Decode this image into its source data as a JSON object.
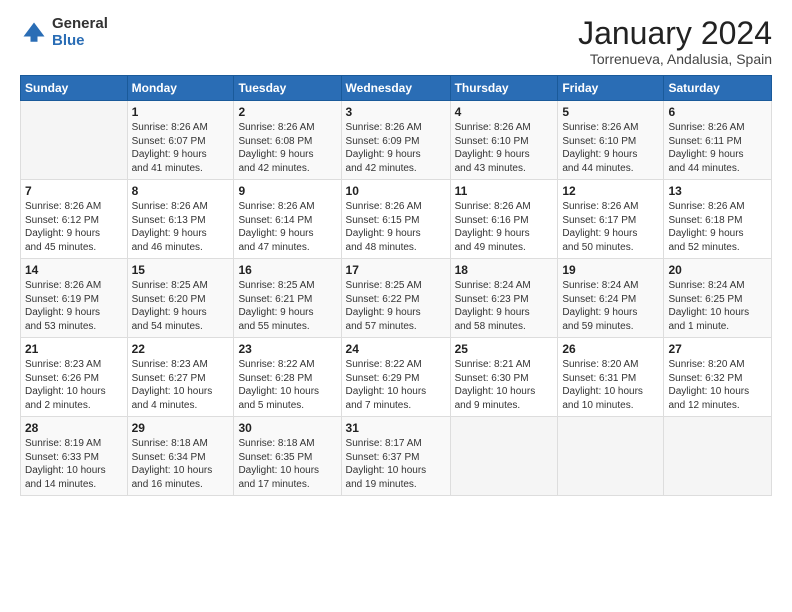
{
  "header": {
    "logo_general": "General",
    "logo_blue": "Blue",
    "month_title": "January 2024",
    "location": "Torrenueva, Andalusia, Spain"
  },
  "weekdays": [
    "Sunday",
    "Monday",
    "Tuesday",
    "Wednesday",
    "Thursday",
    "Friday",
    "Saturday"
  ],
  "weeks": [
    [
      {
        "num": "",
        "info": ""
      },
      {
        "num": "1",
        "info": "Sunrise: 8:26 AM\nSunset: 6:07 PM\nDaylight: 9 hours\nand 41 minutes."
      },
      {
        "num": "2",
        "info": "Sunrise: 8:26 AM\nSunset: 6:08 PM\nDaylight: 9 hours\nand 42 minutes."
      },
      {
        "num": "3",
        "info": "Sunrise: 8:26 AM\nSunset: 6:09 PM\nDaylight: 9 hours\nand 42 minutes."
      },
      {
        "num": "4",
        "info": "Sunrise: 8:26 AM\nSunset: 6:10 PM\nDaylight: 9 hours\nand 43 minutes."
      },
      {
        "num": "5",
        "info": "Sunrise: 8:26 AM\nSunset: 6:10 PM\nDaylight: 9 hours\nand 44 minutes."
      },
      {
        "num": "6",
        "info": "Sunrise: 8:26 AM\nSunset: 6:11 PM\nDaylight: 9 hours\nand 44 minutes."
      }
    ],
    [
      {
        "num": "7",
        "info": "Sunrise: 8:26 AM\nSunset: 6:12 PM\nDaylight: 9 hours\nand 45 minutes."
      },
      {
        "num": "8",
        "info": "Sunrise: 8:26 AM\nSunset: 6:13 PM\nDaylight: 9 hours\nand 46 minutes."
      },
      {
        "num": "9",
        "info": "Sunrise: 8:26 AM\nSunset: 6:14 PM\nDaylight: 9 hours\nand 47 minutes."
      },
      {
        "num": "10",
        "info": "Sunrise: 8:26 AM\nSunset: 6:15 PM\nDaylight: 9 hours\nand 48 minutes."
      },
      {
        "num": "11",
        "info": "Sunrise: 8:26 AM\nSunset: 6:16 PM\nDaylight: 9 hours\nand 49 minutes."
      },
      {
        "num": "12",
        "info": "Sunrise: 8:26 AM\nSunset: 6:17 PM\nDaylight: 9 hours\nand 50 minutes."
      },
      {
        "num": "13",
        "info": "Sunrise: 8:26 AM\nSunset: 6:18 PM\nDaylight: 9 hours\nand 52 minutes."
      }
    ],
    [
      {
        "num": "14",
        "info": "Sunrise: 8:26 AM\nSunset: 6:19 PM\nDaylight: 9 hours\nand 53 minutes."
      },
      {
        "num": "15",
        "info": "Sunrise: 8:25 AM\nSunset: 6:20 PM\nDaylight: 9 hours\nand 54 minutes."
      },
      {
        "num": "16",
        "info": "Sunrise: 8:25 AM\nSunset: 6:21 PM\nDaylight: 9 hours\nand 55 minutes."
      },
      {
        "num": "17",
        "info": "Sunrise: 8:25 AM\nSunset: 6:22 PM\nDaylight: 9 hours\nand 57 minutes."
      },
      {
        "num": "18",
        "info": "Sunrise: 8:24 AM\nSunset: 6:23 PM\nDaylight: 9 hours\nand 58 minutes."
      },
      {
        "num": "19",
        "info": "Sunrise: 8:24 AM\nSunset: 6:24 PM\nDaylight: 9 hours\nand 59 minutes."
      },
      {
        "num": "20",
        "info": "Sunrise: 8:24 AM\nSunset: 6:25 PM\nDaylight: 10 hours\nand 1 minute."
      }
    ],
    [
      {
        "num": "21",
        "info": "Sunrise: 8:23 AM\nSunset: 6:26 PM\nDaylight: 10 hours\nand 2 minutes."
      },
      {
        "num": "22",
        "info": "Sunrise: 8:23 AM\nSunset: 6:27 PM\nDaylight: 10 hours\nand 4 minutes."
      },
      {
        "num": "23",
        "info": "Sunrise: 8:22 AM\nSunset: 6:28 PM\nDaylight: 10 hours\nand 5 minutes."
      },
      {
        "num": "24",
        "info": "Sunrise: 8:22 AM\nSunset: 6:29 PM\nDaylight: 10 hours\nand 7 minutes."
      },
      {
        "num": "25",
        "info": "Sunrise: 8:21 AM\nSunset: 6:30 PM\nDaylight: 10 hours\nand 9 minutes."
      },
      {
        "num": "26",
        "info": "Sunrise: 8:20 AM\nSunset: 6:31 PM\nDaylight: 10 hours\nand 10 minutes."
      },
      {
        "num": "27",
        "info": "Sunrise: 8:20 AM\nSunset: 6:32 PM\nDaylight: 10 hours\nand 12 minutes."
      }
    ],
    [
      {
        "num": "28",
        "info": "Sunrise: 8:19 AM\nSunset: 6:33 PM\nDaylight: 10 hours\nand 14 minutes."
      },
      {
        "num": "29",
        "info": "Sunrise: 8:18 AM\nSunset: 6:34 PM\nDaylight: 10 hours\nand 16 minutes."
      },
      {
        "num": "30",
        "info": "Sunrise: 8:18 AM\nSunset: 6:35 PM\nDaylight: 10 hours\nand 17 minutes."
      },
      {
        "num": "31",
        "info": "Sunrise: 8:17 AM\nSunset: 6:37 PM\nDaylight: 10 hours\nand 19 minutes."
      },
      {
        "num": "",
        "info": ""
      },
      {
        "num": "",
        "info": ""
      },
      {
        "num": "",
        "info": ""
      }
    ]
  ]
}
